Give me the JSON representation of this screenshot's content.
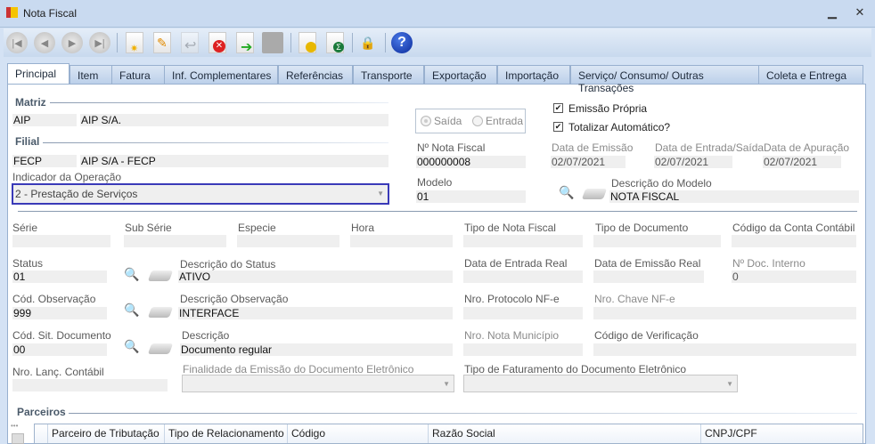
{
  "window": {
    "title": "Nota Fiscal",
    "minimize": "▁",
    "close": "✕"
  },
  "toolbar": [
    "first-record",
    "previous-record",
    "next-record",
    "last-record",
    "new",
    "edit",
    "undo",
    "delete",
    "export",
    "save",
    "report-values",
    "report-totals",
    "lock",
    "help"
  ],
  "tabs": [
    "Principal",
    "Item",
    "Fatura",
    "Inf. Complementares",
    "Referências",
    "Transporte",
    "Exportação",
    "Importação",
    "Serviço/ Consumo/ Outras Transações",
    "Coleta e Entrega"
  ],
  "matriz": {
    "title": "Matriz",
    "code": "AIP",
    "name": "AIP S/A."
  },
  "filial": {
    "title": "Filial",
    "code": "FECP",
    "name": "AIP S/A - FECP"
  },
  "indicador": {
    "label": "Indicador da Operação",
    "value": "2 - Prestação de Serviços"
  },
  "direction": {
    "saida": "Saída",
    "entrada": "Entrada"
  },
  "checks": {
    "emissao_propria": "Emissão Própria",
    "totalizar": "Totalizar Automático?"
  },
  "nota": {
    "numero_label": "Nº Nota Fiscal",
    "numero": "000000008",
    "data_emissao_label": "Data de Emissão",
    "data_emissao": "02/07/2021",
    "data_es_label": "Data de Entrada/Saída",
    "data_es": "02/07/2021",
    "data_apuracao_label": "Data de Apuração",
    "data_apuracao": "02/07/2021",
    "modelo_label": "Modelo",
    "modelo": "01",
    "desc_modelo_label": "Descrição do Modelo",
    "desc_modelo": "NOTA FISCAL"
  },
  "row1": {
    "serie": "Série",
    "sub_serie": "Sub Série",
    "especie": "Especie",
    "hora": "Hora",
    "tipo_nf": "Tipo de Nota Fiscal",
    "tipo_doc": "Tipo de Documento",
    "conta": "Código da Conta Contábil"
  },
  "row2": {
    "status_label": "Status",
    "status": "01",
    "desc_status_label": "Descrição do Status",
    "desc_status": "ATIVO",
    "data_entrada_real": "Data de Entrada Real",
    "data_emissao_real": "Data de Emissão Real",
    "doc_interno_label": "Nº Doc. Interno",
    "doc_interno": "0"
  },
  "row3": {
    "cod_obs_label": "Cód. Observação",
    "cod_obs": "999",
    "desc_obs_label": "Descrição Observação",
    "desc_obs": "INTERFACE",
    "protocolo": "Nro. Protocolo NF-e",
    "chave": "Nro. Chave NF-e"
  },
  "row4": {
    "cod_sit_label": "Cód. Sit. Documento",
    "cod_sit": "00",
    "desc_label": "Descrição",
    "desc": "Documento regular",
    "nota_municipio": "Nro. Nota Município",
    "cod_verificacao": "Código de Verificação"
  },
  "row5": {
    "lanc_contabil": "Nro. Lanç. Contábil",
    "finalidade": "Finalidade da Emissão do Documento Eletrônico",
    "tipo_faturamento": "Tipo de Faturamento do Documento Eletrônico"
  },
  "parceiros": {
    "title": "Parceiros",
    "columns": [
      "Parceiro de Tributação",
      "Tipo de Relacionamento",
      "Código",
      "Razão Social",
      "CNPJ/CPF"
    ]
  }
}
